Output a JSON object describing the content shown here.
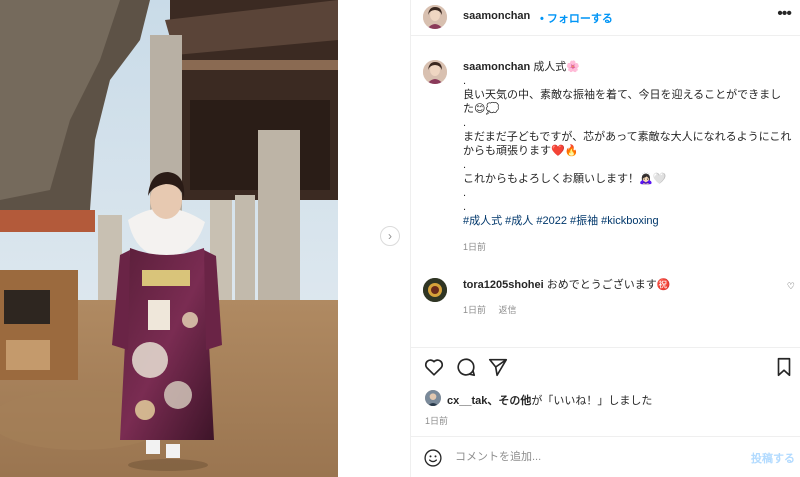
{
  "post": {
    "username": "saamonchan",
    "separator": "•",
    "follow_label": "フォローする",
    "more_icon": "more-horizontal-icon"
  },
  "caption": {
    "username": "saamonchan",
    "title": "成人式🌸",
    "lines": [
      ".",
      "良い天気の中、素敵な振袖を着て、今日を迎えることができまし",
      "た😊💭",
      ".",
      "まだまだ子どもですが、芯があって素敵な大人になれるようにこれからも頑張ります❤️🔥",
      ".",
      "これからもよろしくお願いします！🙇🏻‍♀️🤍",
      ".",
      "."
    ],
    "hashtags": "#成人式 #成人 #2022 #振袖 #kickboxing",
    "time": "1日前"
  },
  "comment": {
    "username": "tora1205shohei",
    "text": "おめでとうございます㊗️",
    "time": "1日前",
    "reply_label": "返信"
  },
  "actions": {
    "like_icon": "heart-icon",
    "comment_icon": "comment-icon",
    "share_icon": "send-icon",
    "save_icon": "bookmark-icon"
  },
  "likes": {
    "user": "cx__tak",
    "and_others": "、その他",
    "suffix": "が「いいね！」しました"
  },
  "post_time": "1日前",
  "add_comment": {
    "placeholder": "コメントを追加...",
    "post_label": "投稿する"
  },
  "colors": {
    "link_blue": "#0095f6",
    "hashtag": "#00376b",
    "muted": "#8e8e8e",
    "post_disabled": "#b3dbff"
  }
}
